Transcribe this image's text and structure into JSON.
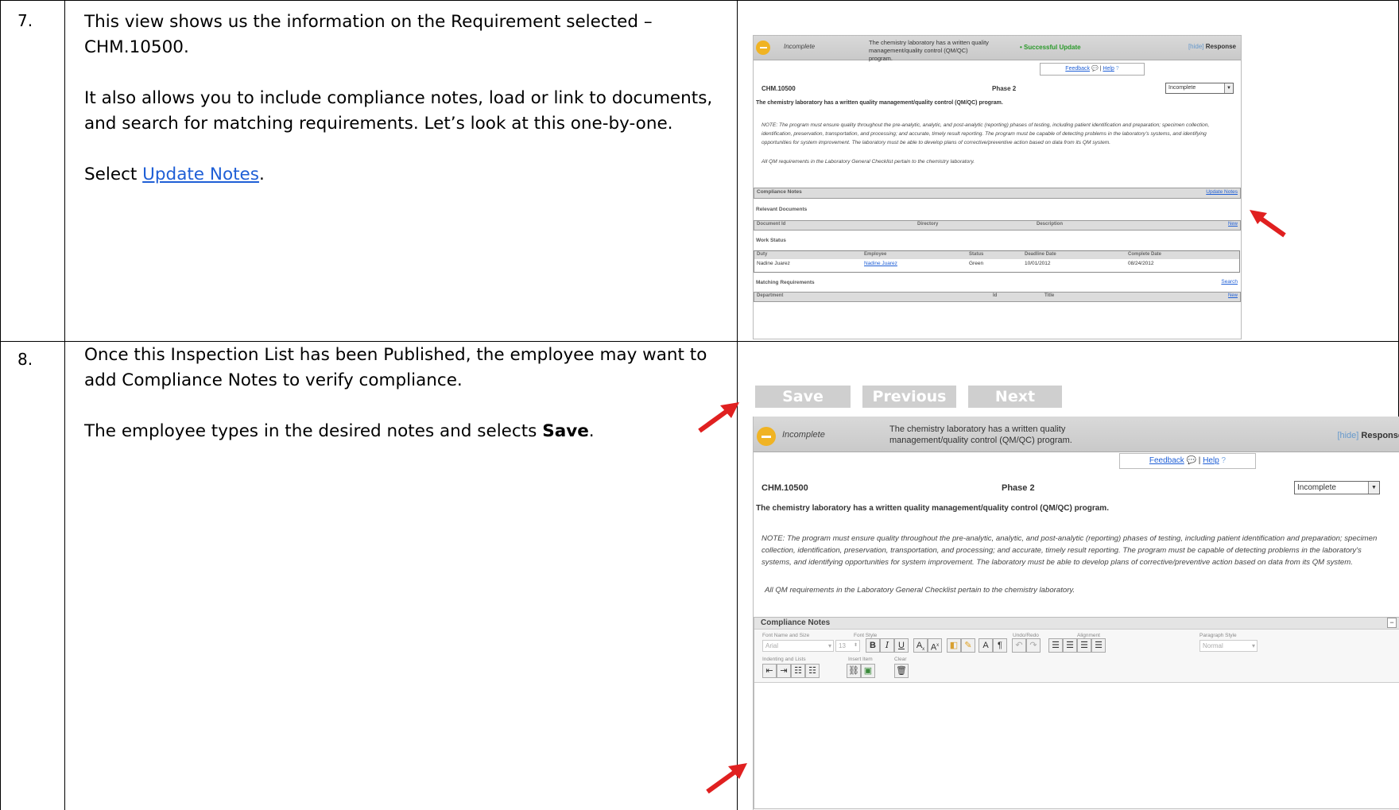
{
  "steps": [
    {
      "number": "7.",
      "para1": "This view shows us the information on the Requirement selected – CHM.10500.",
      "para2": "It also allows you to include compliance notes, load or link to documents, and search for matching requirements.  Let’s look at this one-by-one.",
      "select_prefix": "Select ",
      "select_link": "Update Notes",
      "select_suffix": "."
    },
    {
      "number": "8.",
      "para1": "Once this Inspection List has been Published, the employee may want to add Compliance Notes to verify compliance.",
      "para2_prefix": "The employee types in the desired notes and selects ",
      "para2_bold": "Save",
      "para2_suffix": "."
    }
  ],
  "shot1": {
    "status": "Incomplete",
    "req_title": "The chemistry laboratory has a written quality management/quality control (QM/QC) program.",
    "update_msg": "• Successful Update",
    "hide": "[hide]",
    "response": "Response",
    "feedback": "Feedback",
    "help": "Help",
    "req_id": "CHM.10500",
    "phase": "Phase 2",
    "status_select": "Incomplete",
    "req_bold": "The chemistry laboratory has a written quality management/quality control (QM/QC) program.",
    "note": "NOTE:  The program must ensure quality throughout the pre-analytic, analytic, and post-analytic (reporting) phases of testing, including patient identification and preparation; specimen collection, identification, preservation, transportation, and processing; and accurate, timely result reporting.  The program must be capable of detecting problems in the laboratory's systems, and identifying opportunities for system improvement.  The laboratory must be able to develop plans of corrective/preventive action based on data from its QM system.",
    "note2": "All QM requirements in the Laboratory General Checklist pertain to the chemistry laboratory.",
    "compliance_notes": "Compliance Notes",
    "update_notes": "Update Notes",
    "relevant_docs": "Relevant Documents",
    "doc_cols": [
      "Document Id",
      "Directory",
      "Description"
    ],
    "new": "New",
    "work_status": "Work Status",
    "ws_cols": [
      "Duty",
      "Employee",
      "Status",
      "Deadline Date",
      "Complete Date"
    ],
    "ws_row": [
      "Nadine Juarez",
      "Nadine Juarez",
      "Green",
      "10/01/2012",
      "08/24/2012"
    ],
    "matching": "Matching Requirements",
    "search": "Search",
    "mr_cols": [
      "Department",
      "Id",
      "Title"
    ]
  },
  "shot2": {
    "buttons": [
      "Save",
      "Previous",
      "Next"
    ],
    "status": "Incomplete",
    "req_title_l1": "The chemistry laboratory has a written quality",
    "req_title_l2": "management/quality control (QM/QC) program.",
    "hide": "[hide]",
    "response": "Response",
    "feedback": "Feedback",
    "help": "Help",
    "req_id": "CHM.10500",
    "phase": "Phase 2",
    "status_select": "Incomplete",
    "req_bold": "The chemistry laboratory has a written quality management/quality control (QM/QC) program.",
    "note": "NOTE:  The program must ensure quality throughout the pre-analytic, analytic, and post-analytic (reporting) phases of testing, including patient identification and preparation; specimen collection, identification, preservation, transportation, and processing; and accurate, timely result reporting.  The program must be capable of detecting problems in the laboratory's systems, and identifying opportunities for system improvement.  The laboratory must be able to develop plans of corrective/preventive action based on data from its QM system.",
    "note2": "All QM requirements in the Laboratory General Checklist pertain to the chemistry laboratory.",
    "compliance_notes": "Compliance Notes",
    "collapse": "−",
    "toolbar_groups": [
      "Font Name and Size",
      "Font Style",
      "Undo/Redo",
      "Alignment",
      "Paragraph Style",
      "Indenting and Lists",
      "Insert Item",
      "Clear"
    ],
    "font_name": "Arial",
    "font_size": "13",
    "para_style": "Normal"
  }
}
